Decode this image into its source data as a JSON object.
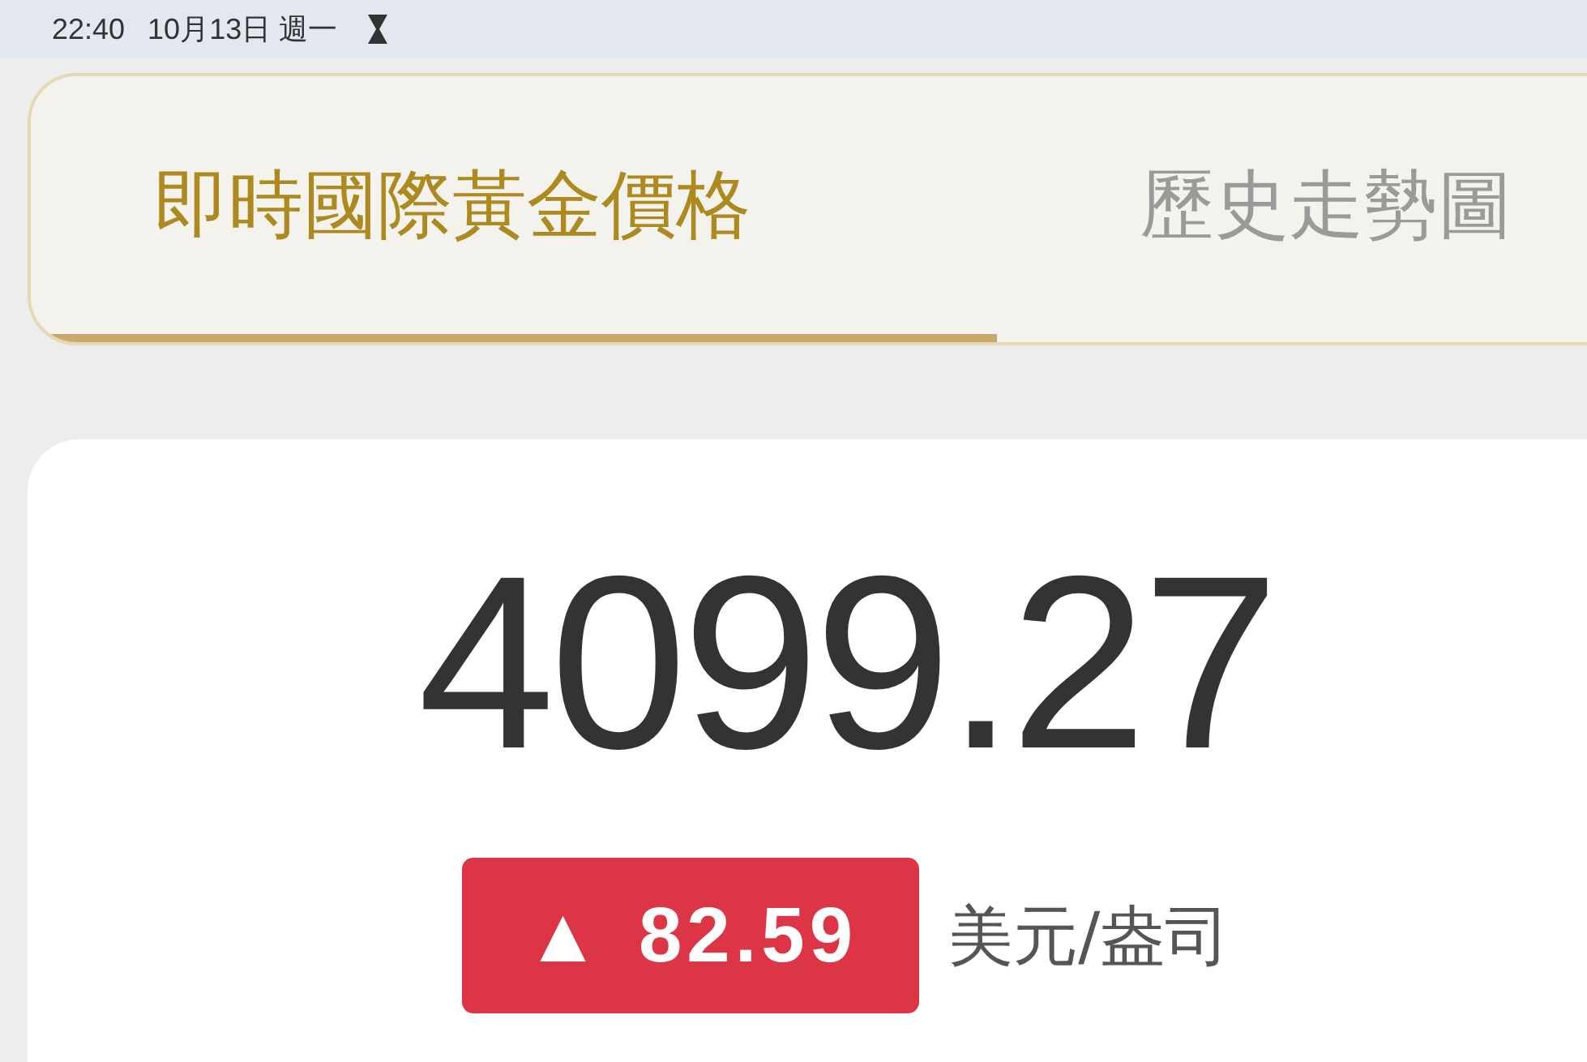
{
  "status_bar": {
    "time": "22:40",
    "date": "10月13日 週一"
  },
  "tabs": [
    {
      "label": "即時國際黃金價格",
      "selected": true
    },
    {
      "label": "歷史走勢圖",
      "selected": false
    }
  ],
  "price_card": {
    "price": "4099.27",
    "change": {
      "rising": true,
      "arrow": "▲",
      "value": "82.59"
    },
    "unit": "美元/盎司"
  }
}
